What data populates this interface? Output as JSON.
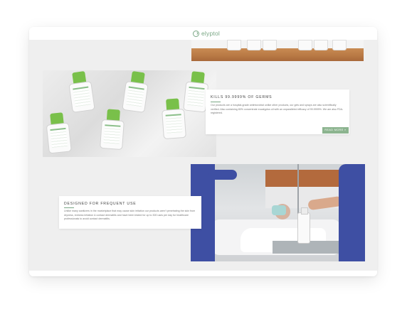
{
  "header": {
    "logo_text": "elyptol",
    "logo_icon": "elyptol-logo-icon"
  },
  "sections": [
    {
      "id": "germs",
      "title": "KILLS 99.9999% OF GERMS",
      "body": "Our products are a hospital-grade antimicrobial unlike other products, our gels and sprays are also scientifically verified. Also containing 80% concentrate eucalyptus oil with an unparalleled efficacy of 99.9999%. We are also FDA-registered.",
      "button_label": "READ MORE »"
    },
    {
      "id": "frequent-use",
      "title": "DESIGNED FOR FREQUENT USE",
      "body": "Unlike many sanitizers in the marketplace that may cause skin irritation our products aren't penetrating the skin from dryness, redness irritation & contact dermatitis and have been tested for up to 300 uses per day for healthcare professionals to avoid contact dermatitis."
    }
  ],
  "images": {
    "shelf": "elyptol bottles on wooden shelf",
    "marble": "elyptol bottles on marble",
    "hospital": "nurse applying sanitizer next to patient"
  },
  "colors": {
    "accent": "#8cb48f",
    "brand": "#7aa785",
    "background": "#efefef"
  }
}
